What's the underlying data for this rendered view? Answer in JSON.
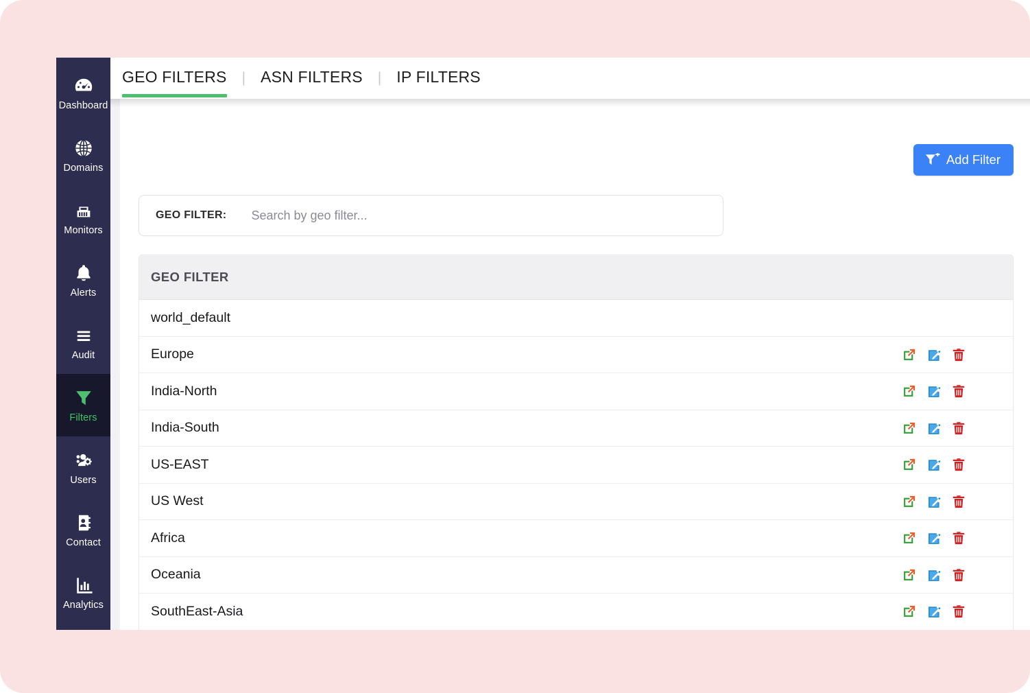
{
  "colors": {
    "page_background": "#fbe2e2",
    "sidebar_background": "#2d2e4f",
    "sidebar_active_background": "#17182b",
    "accent_green": "#4fbf6f",
    "accent_blue": "#3b82f6",
    "action_green": "#2e9e35",
    "action_blue": "#2a8fd4",
    "action_red": "#d32020",
    "table_header_background": "#f0f0f2"
  },
  "sidebar": {
    "items": [
      {
        "label": "Dashboard",
        "icon": "gauge-icon",
        "active": false
      },
      {
        "label": "Domains",
        "icon": "globe-icon",
        "active": false
      },
      {
        "label": "Monitors",
        "icon": "network-port-icon",
        "active": false
      },
      {
        "label": "Alerts",
        "icon": "bell-icon",
        "active": false
      },
      {
        "label": "Audit",
        "icon": "list-lines-icon",
        "active": false
      },
      {
        "label": "Filters",
        "icon": "funnel-icon",
        "active": true
      },
      {
        "label": "Users",
        "icon": "users-gear-icon",
        "active": false
      },
      {
        "label": "Contact",
        "icon": "address-book-icon",
        "active": false
      },
      {
        "label": "Analytics",
        "icon": "bar-chart-icon",
        "active": false
      }
    ]
  },
  "tabs": [
    {
      "label": "GEO FILTERS",
      "active": true
    },
    {
      "label": "ASN FILTERS",
      "active": false
    },
    {
      "label": "IP FILTERS",
      "active": false
    }
  ],
  "tab_separator": "|",
  "toolbar": {
    "add_filter_label": "Add Filter",
    "add_filter_icon": "funnel-plus-icon"
  },
  "search": {
    "label": "GEO FILTER:",
    "placeholder": "Search by geo filter...",
    "value": ""
  },
  "table": {
    "columns": [
      "GEO FILTER"
    ],
    "row_action_icons": [
      "external-link-icon",
      "edit-pencil-icon",
      "trash-icon"
    ],
    "rows": [
      {
        "name": "world_default",
        "has_actions": false
      },
      {
        "name": "Europe",
        "has_actions": true
      },
      {
        "name": "India-North",
        "has_actions": true
      },
      {
        "name": "India-South",
        "has_actions": true
      },
      {
        "name": "US-EAST",
        "has_actions": true
      },
      {
        "name": "US West",
        "has_actions": true
      },
      {
        "name": "Africa",
        "has_actions": true
      },
      {
        "name": "Oceania",
        "has_actions": true
      },
      {
        "name": "SouthEast-Asia",
        "has_actions": true
      }
    ]
  }
}
